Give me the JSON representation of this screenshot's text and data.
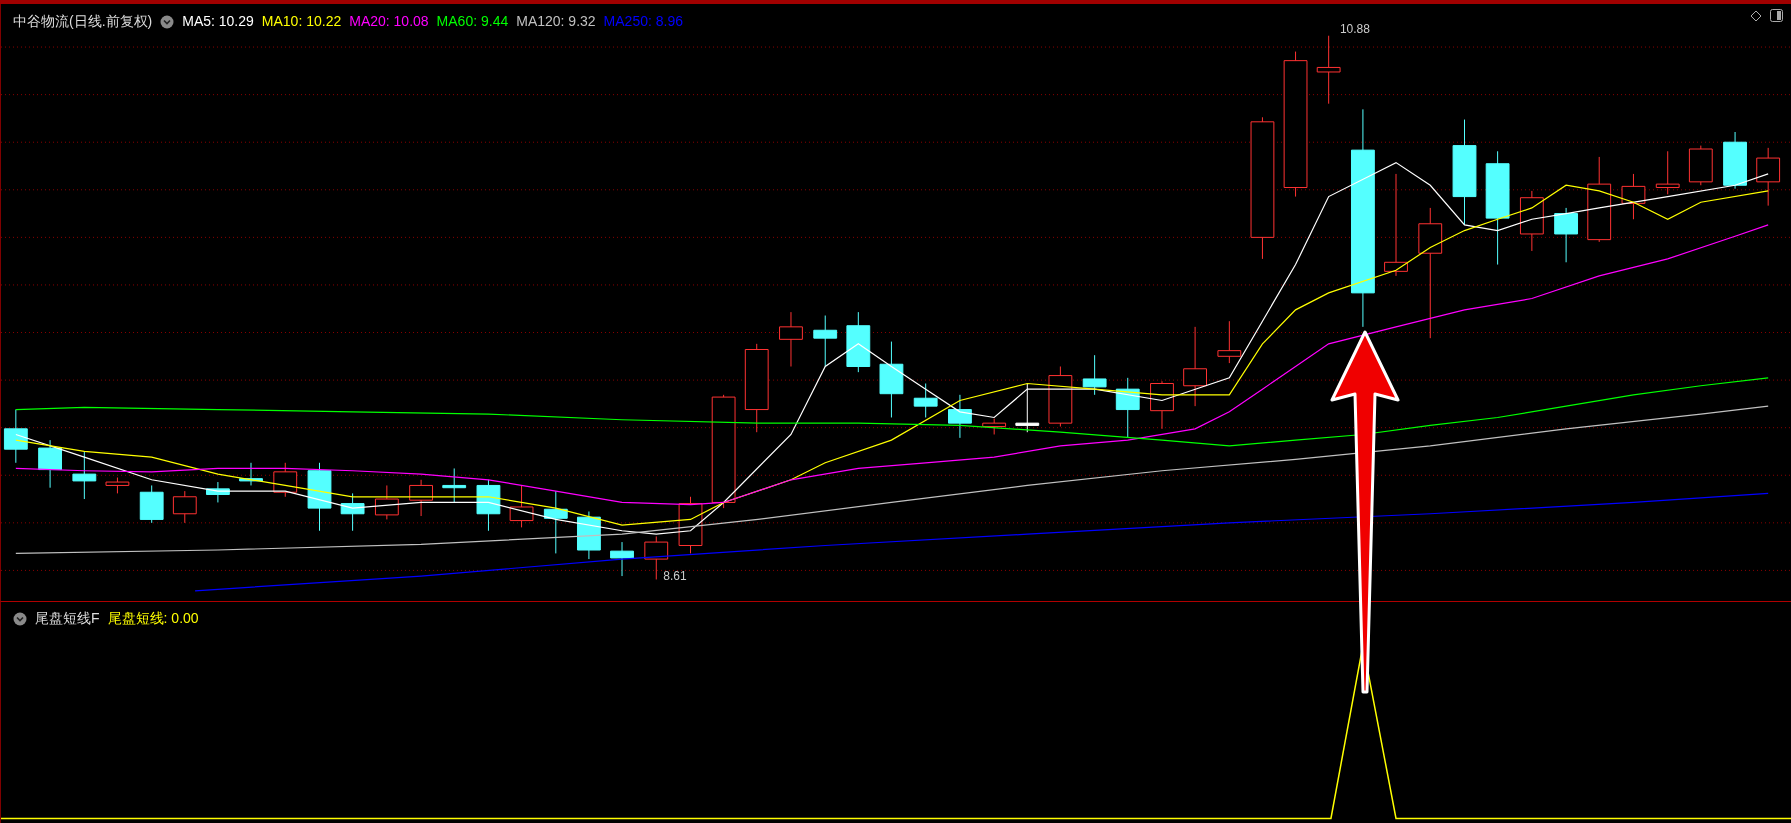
{
  "chart": {
    "title": "中谷物流(日线.前复权)",
    "ma_legend": [
      {
        "label": "MA5: 10.29",
        "color": "#ffffff"
      },
      {
        "label": "MA10: 10.22",
        "color": "#ffff00"
      },
      {
        "label": "MA20: 10.08",
        "color": "#ff00ff"
      },
      {
        "label": "MA60: 9.44",
        "color": "#00ff00"
      },
      {
        "label": "MA120: 9.32",
        "color": "#c0c0c0"
      },
      {
        "label": "MA250: 8.96",
        "color": "#0000ff"
      }
    ],
    "high_label": "10.88",
    "low_label": "8.61"
  },
  "indicator": {
    "name": "尾盘短线F",
    "value_label": "尾盘短线: 0.00"
  }
}
